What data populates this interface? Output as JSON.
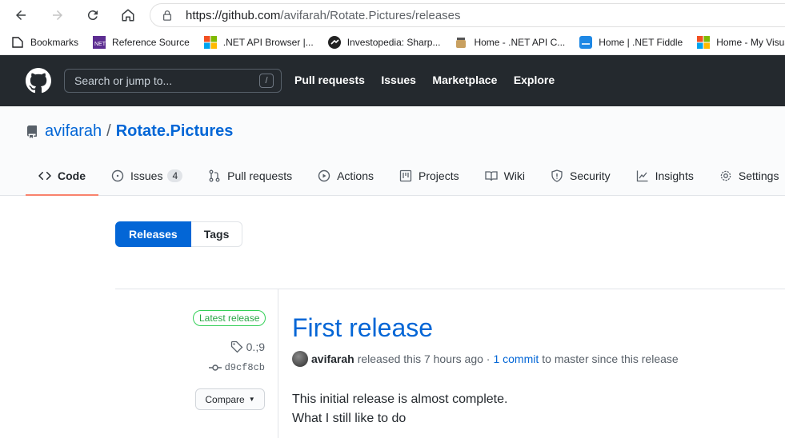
{
  "browser": {
    "url_host": "https://github.com",
    "url_path": "/avifarah/Rotate.Pictures/releases",
    "bookmarks": [
      {
        "label": "Bookmarks",
        "icon": "bookmark-folder-icon"
      },
      {
        "label": "Reference Source",
        "icon": "dotnet-icon"
      },
      {
        "label": ".NET API Browser |...",
        "icon": "microsoft-icon"
      },
      {
        "label": "Investopedia: Sharp...",
        "icon": "investopedia-icon"
      },
      {
        "label": "Home - .NET API C...",
        "icon": "jar-icon"
      },
      {
        "label": "Home | .NET Fiddle",
        "icon": "fiddle-icon"
      },
      {
        "label": "Home - My Visual S...",
        "icon": "microsoft-icon"
      }
    ]
  },
  "header": {
    "search_placeholder": "Search or jump to...",
    "search_shortcut": "/",
    "nav": [
      "Pull requests",
      "Issues",
      "Marketplace",
      "Explore"
    ]
  },
  "repo": {
    "owner": "avifarah",
    "separator": "/",
    "name": "Rotate.Pictures",
    "tabs": [
      {
        "label": "Code",
        "icon": "code-icon"
      },
      {
        "label": "Issues",
        "icon": "issue-icon",
        "count": "4"
      },
      {
        "label": "Pull requests",
        "icon": "pull-request-icon"
      },
      {
        "label": "Actions",
        "icon": "play-icon"
      },
      {
        "label": "Projects",
        "icon": "project-icon"
      },
      {
        "label": "Wiki",
        "icon": "book-icon"
      },
      {
        "label": "Security",
        "icon": "shield-icon"
      },
      {
        "label": "Insights",
        "icon": "graph-icon"
      },
      {
        "label": "Settings",
        "icon": "gear-icon"
      }
    ]
  },
  "subnav": {
    "releases": "Releases",
    "tags": "Tags"
  },
  "release": {
    "badge": "Latest release",
    "tag": "0.;9",
    "commit": "d9cf8cb",
    "compare": "Compare",
    "title": "First release",
    "author": "avifarah",
    "released_text": "released this 7 hours ago ·",
    "commit_link": "1 commit",
    "since_text": "to master since this release",
    "body_line1": "This initial release is almost complete.",
    "body_line2": "What I still like to do"
  },
  "colors": {
    "accent": "#0366d6",
    "header_bg": "#24292e",
    "tab_underline": "#f9826c",
    "latest_green": "#28a745"
  }
}
